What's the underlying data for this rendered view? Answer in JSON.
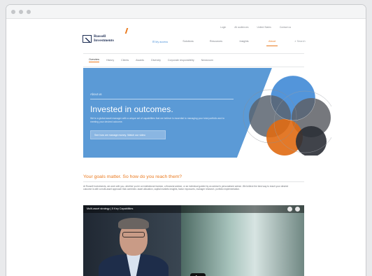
{
  "utility_nav": [
    "Login",
    "All audiences",
    "United States",
    "Contact us"
  ],
  "logo": {
    "line1": "Russell",
    "line2": "Investments"
  },
  "main_nav": [
    {
      "label": "My access",
      "state": "myaccess"
    },
    {
      "label": "Solutions",
      "state": ""
    },
    {
      "label": "Resources",
      "state": ""
    },
    {
      "label": "Insights",
      "state": ""
    },
    {
      "label": "About",
      "state": "about"
    },
    {
      "label": "Search",
      "state": "search"
    }
  ],
  "sub_nav": [
    "Overview",
    "History",
    "Clients",
    "Awards",
    "Diversity",
    "Corporate responsibility",
    "Newsroom"
  ],
  "hero": {
    "eyebrow": "About us",
    "title": "Invested in outcomes.",
    "description": "We're a global asset manager with a unique set of capabilities that we believe is essential to managing your total portfolio and to meeting your desired outcome.",
    "button_label": "See how we manage money. Watch our video"
  },
  "goals": {
    "title": "Your goals matter. So how do you reach them?",
    "body": "At Russell Investments, we work with you, whether you're an institutional investor, a financial adviser, or an individual guided by an adviser's personalized advice. We believe the best way to reach your desired outcome is with a multi-asset approach that combines: asset allocation, capital markets insights, factor exposures, manager research, portfolio implementation."
  },
  "video": {
    "title": "Multi-asset strategy | 5 Key Capabilities"
  },
  "colors": {
    "accent": "#ea7a1f",
    "hero_blue": "#5b9ad6",
    "navy": "#1f2f55"
  },
  "icons": {
    "play": "play-icon",
    "share": "share-icon",
    "watch_later": "clock-icon"
  }
}
